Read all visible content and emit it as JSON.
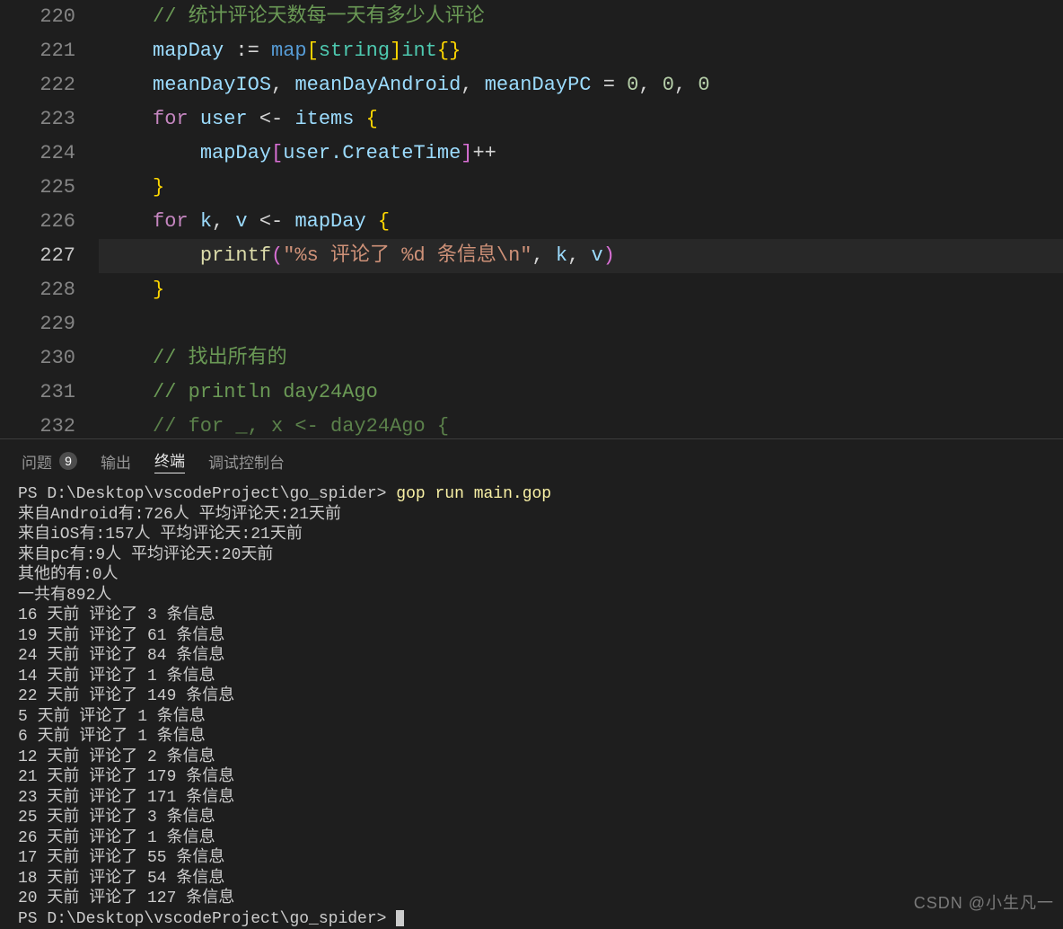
{
  "editor": {
    "lines": {
      "220": {
        "num": "220",
        "comment": "// 统计评论天数每一天有多少人评论"
      },
      "221": {
        "num": "221",
        "ident": "mapDay",
        "op": " := ",
        "kw_map": "map",
        "lb": "[",
        "t_string": "string",
        "rb": "]",
        "t_int": "int",
        "braces": "{}"
      },
      "222": {
        "num": "222",
        "a": "meanDayIOS",
        "b": "meanDayAndroid",
        "c": "meanDayPC",
        "eq": " = ",
        "z1": "0",
        "z2": "0",
        "z3": "0"
      },
      "223": {
        "num": "223",
        "for": "for",
        "user": "user",
        "arrow": " <- ",
        "items": "items",
        "ob": " {"
      },
      "224": {
        "num": "224",
        "map": "mapDay",
        "lb": "[",
        "expr": "user.CreateTime",
        "rb": "]",
        "pp": "++"
      },
      "225": {
        "num": "225",
        "cb": "}"
      },
      "226": {
        "num": "226",
        "for": "for",
        "k": "k",
        "v": "v",
        "arrow": " <- ",
        "mapDay": "mapDay",
        "ob": " {"
      },
      "227": {
        "num": "227",
        "fn": "printf",
        "lp": "(",
        "s1": "\"%s ",
        "s2": "评论了",
        "s3": " %d ",
        "s4": "条信息",
        "s5": "\\n\"",
        "k": "k",
        "v": "v",
        "rp": ")"
      },
      "228": {
        "num": "228",
        "cb": "}"
      },
      "229": {
        "num": "229"
      },
      "230": {
        "num": "230",
        "comment": "// 找出所有的"
      },
      "231": {
        "num": "231",
        "comment": "// println day24Ago"
      },
      "232": {
        "num": "232",
        "comment": "// for _, x <- day24Ago {"
      }
    }
  },
  "panel": {
    "tabs": {
      "problems": "问题",
      "problems_count": "9",
      "output": "输出",
      "terminal": "终端",
      "debug": "调试控制台"
    }
  },
  "terminal": {
    "prompt": "PS D:\\Desktop\\vscodeProject\\go_spider> ",
    "command": "gop run main.gop",
    "lines": [
      "来自Android有:726人 平均评论天:21天前",
      "来自iOS有:157人 平均评论天:21天前",
      "来自pc有:9人 平均评论天:20天前",
      "其他的有:0人",
      "一共有892人",
      "16 天前 评论了 3 条信息",
      "19 天前 评论了 61 条信息",
      "24 天前 评论了 84 条信息",
      "14 天前 评论了 1 条信息",
      "22 天前 评论了 149 条信息",
      "5 天前 评论了 1 条信息",
      "6 天前 评论了 1 条信息",
      "12 天前 评论了 2 条信息",
      "21 天前 评论了 179 条信息",
      "23 天前 评论了 171 条信息",
      "25 天前 评论了 3 条信息",
      "26 天前 评论了 1 条信息",
      "17 天前 评论了 55 条信息",
      "18 天前 评论了 54 条信息",
      "20 天前 评论了 127 条信息"
    ],
    "prompt2": "PS D:\\Desktop\\vscodeProject\\go_spider> "
  },
  "watermark": "CSDN @小生凡一"
}
